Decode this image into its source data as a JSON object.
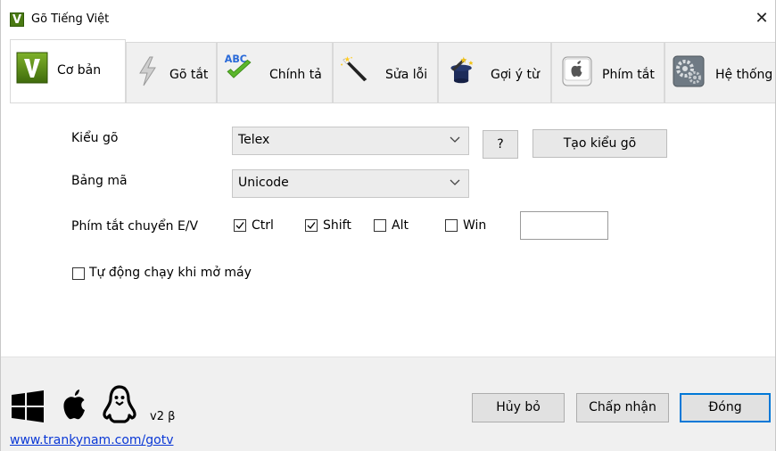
{
  "window": {
    "title": "Gõ Tiếng Việt",
    "app_icon_letter": "V",
    "close_glyph": "✕"
  },
  "tabs": [
    {
      "label": "Cơ bản",
      "icon": "v-logo-icon",
      "active": true
    },
    {
      "label": "Gõ tắt",
      "icon": "lightning-icon"
    },
    {
      "label": "Chính tả",
      "icon": "abc-check-icon",
      "icon_text": "ABC"
    },
    {
      "label": "Sửa lỗi",
      "icon": "magic-wand-icon"
    },
    {
      "label": "Gợi ý từ",
      "icon": "magic-hat-icon"
    },
    {
      "label": "Phím tắt",
      "icon": "apple-key-icon"
    },
    {
      "label": "Hệ thống",
      "icon": "gear-system-icon"
    }
  ],
  "form": {
    "input_method": {
      "label": "Kiểu gõ",
      "value": "Telex",
      "help_label": "?",
      "create_label": "Tạo kiểu gõ"
    },
    "charset": {
      "label": "Bảng mã",
      "value": "Unicode"
    },
    "hotkey": {
      "label": "Phím tắt chuyển E/V",
      "options": [
        {
          "label": "Ctrl",
          "checked": true
        },
        {
          "label": "Shift",
          "checked": true
        },
        {
          "label": "Alt",
          "checked": false
        },
        {
          "label": "Win",
          "checked": false
        }
      ],
      "key_value": ""
    },
    "autostart": {
      "label": "Tự động chạy khi mở máy",
      "checked": false
    }
  },
  "footer": {
    "platform_icons": [
      "windows-icon",
      "apple-icon",
      "linux-icon"
    ],
    "version": "v2 β",
    "link": "www.trankynam.com/gotv",
    "buttons": {
      "cancel": "Hủy bỏ",
      "apply": "Chấp nhận",
      "close": "Đóng"
    }
  },
  "colors": {
    "accent": "#0078d7",
    "link": "#0a38d6",
    "brand_green": "#4a7a12"
  }
}
